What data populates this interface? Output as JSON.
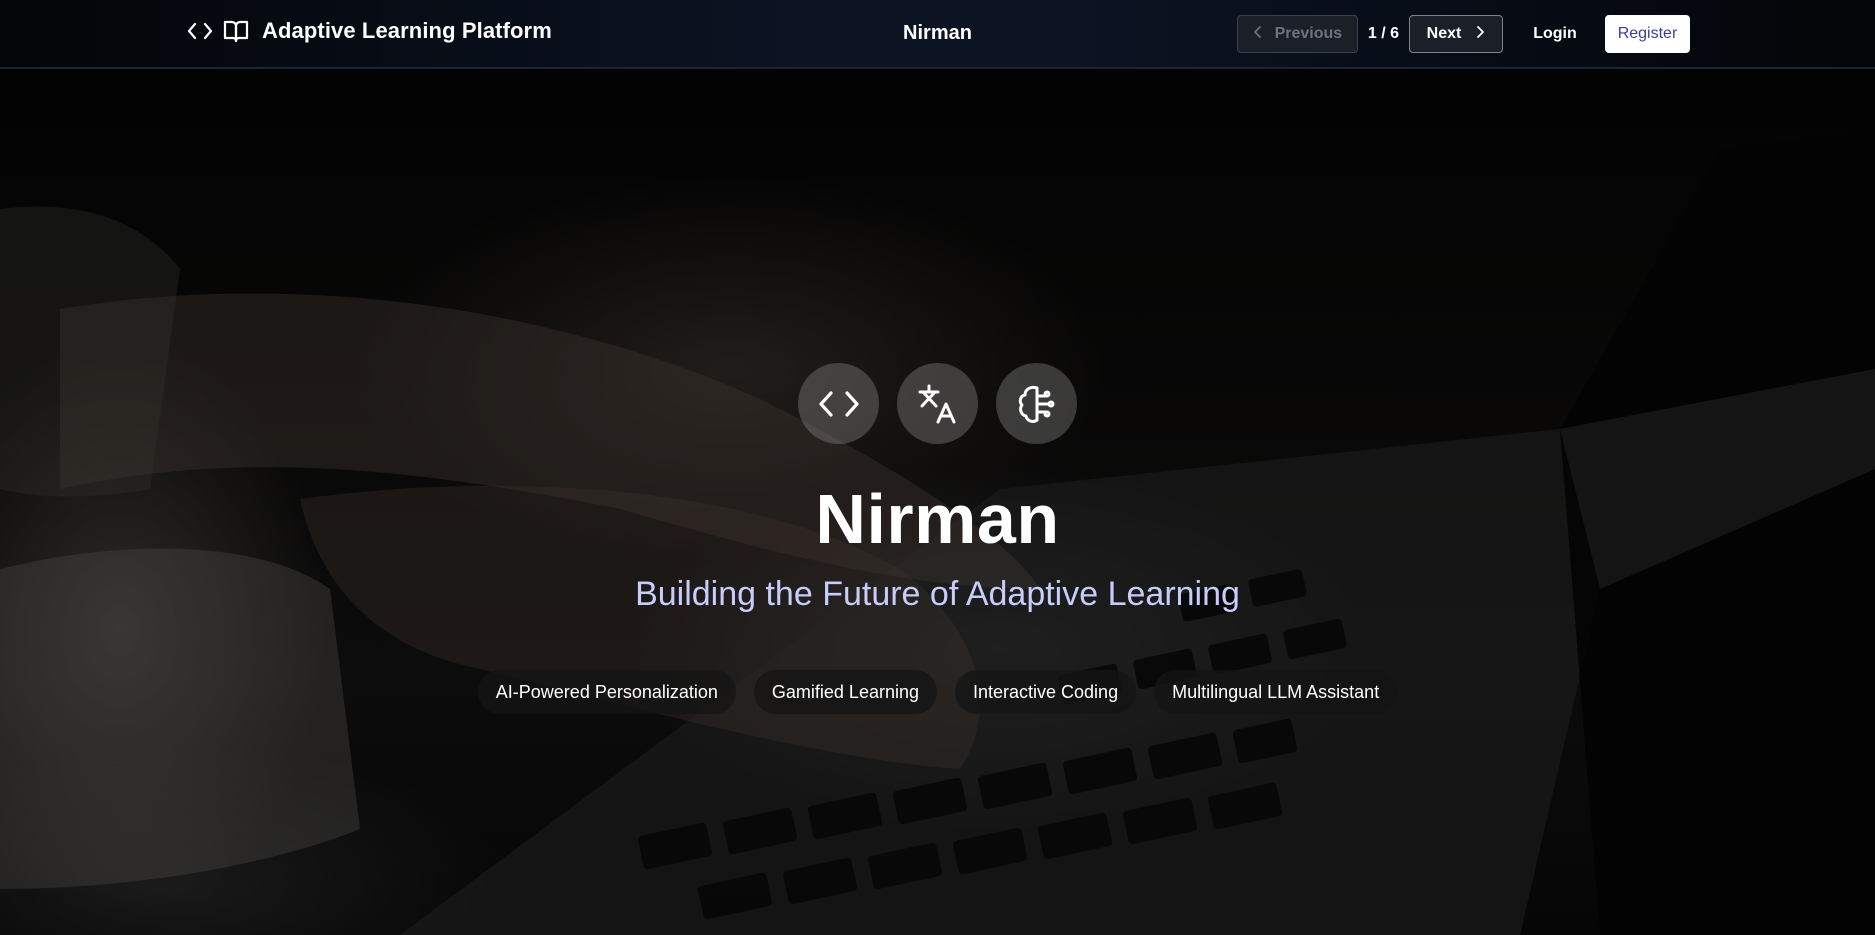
{
  "header": {
    "brand_title": "Adaptive Learning Platform",
    "center_title": "Nirman",
    "previous_label": "Previous",
    "next_label": "Next",
    "slide_counter": "1 / 6",
    "login_label": "Login",
    "register_label": "Register",
    "icons": [
      "code-icon",
      "book-open-icon",
      "chevron-left-icon",
      "chevron-right-icon"
    ]
  },
  "hero": {
    "icons": [
      "code-icon",
      "translate-icon",
      "brain-icon"
    ],
    "title": "Nirman",
    "subtitle": "Building the Future of Adaptive Learning",
    "features": [
      "AI-Powered Personalization",
      "Gamified Learning",
      "Interactive Coding",
      "Multilingual LLM Assistant"
    ]
  },
  "colors": {
    "subtitle": "#c7cdfa",
    "register_text": "#3b3f9d",
    "header_bg": "#0c1424"
  }
}
